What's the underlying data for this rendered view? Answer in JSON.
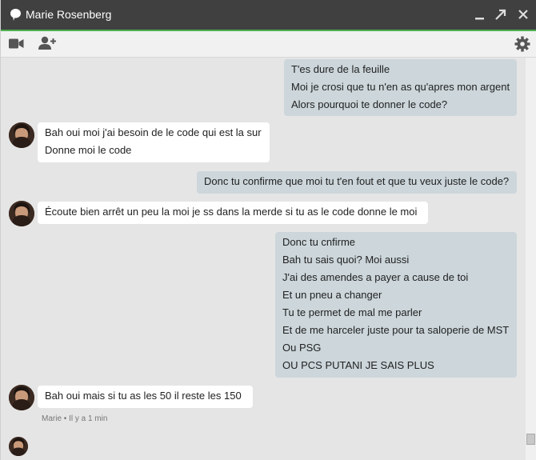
{
  "window": {
    "title": "Marie Rosenberg",
    "accent_color": "#4caf50"
  },
  "toolbar": {
    "video_icon": "video-call-icon",
    "add_user_icon": "add-person-icon",
    "settings_icon": "gear-icon"
  },
  "messages": [
    {
      "direction": "out",
      "lines": [
        "T'es dure de la feuille",
        "Moi je crosi que tu n'en as qu'apres mon argent",
        "Alors pourquoi te donner le code?"
      ]
    },
    {
      "direction": "in",
      "lines": [
        "Bah oui moi j'ai besoin de le code qui est la sur",
        "Donne moi le code"
      ]
    },
    {
      "direction": "out",
      "lines": [
        "Donc tu confirme que moi tu t'en fout et que tu veux juste le code?"
      ]
    },
    {
      "direction": "in",
      "lines": [
        "Écoute bien arrêt un peu la moi je ss dans la merde si tu as le code donne le moi"
      ]
    },
    {
      "direction": "out",
      "lines": [
        "Donc tu cnfirme",
        "Bah tu sais quoi? Moi aussi",
        "J'ai des amendes a payer a cause de toi",
        "Et un pneu a changer",
        "Tu te permet de mal me parler",
        "Et de me harceler juste pour ta saloperie de MST",
        "Ou PSG",
        "OU PCS PUTANI JE SAIS PLUS"
      ]
    },
    {
      "direction": "in",
      "lines": [
        "Bah oui mais si tu as les 50 il reste les 150"
      ]
    }
  ],
  "last_meta": "Marie • Il y a 1 min"
}
